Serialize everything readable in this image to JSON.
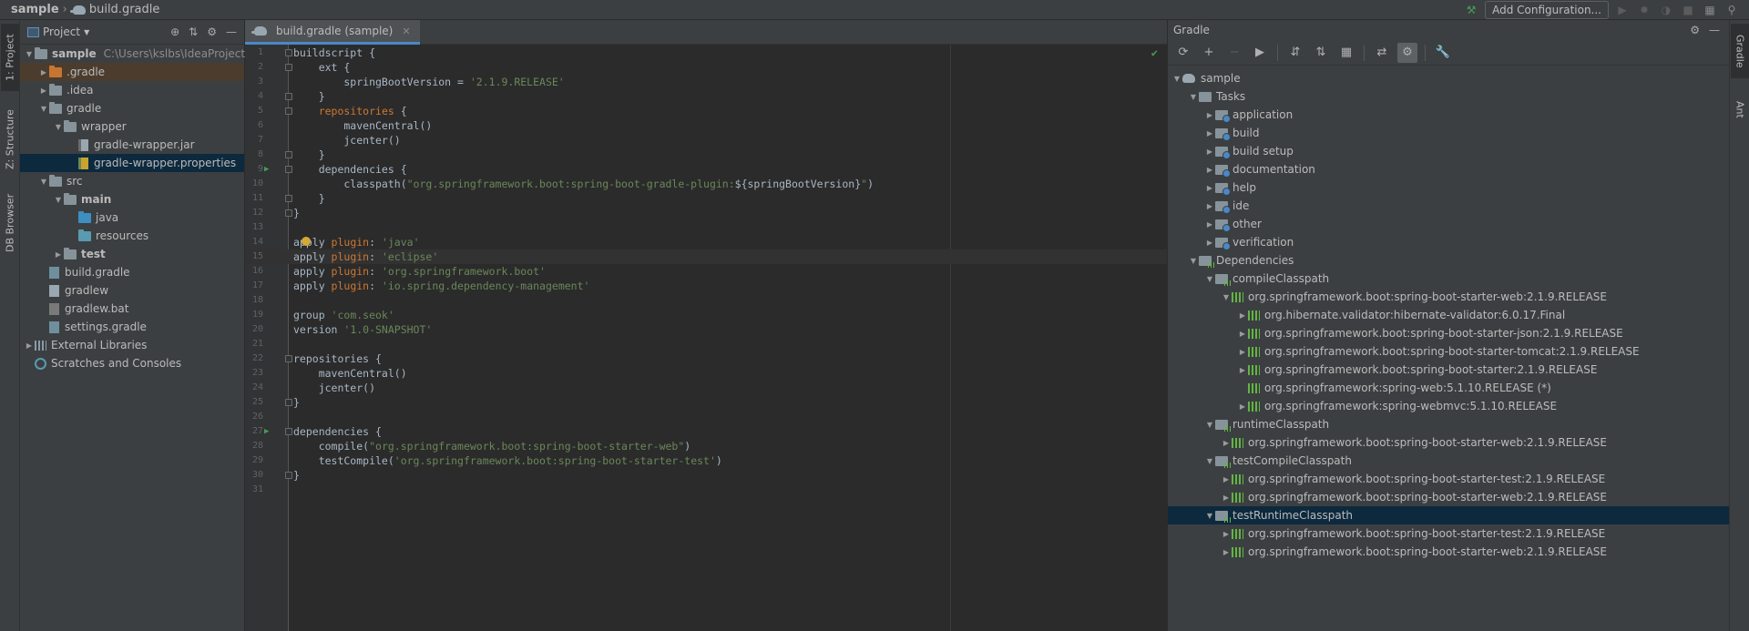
{
  "topbar": {
    "crumbs": [
      "sample",
      "build.gradle"
    ],
    "add_configuration": "Add Configuration..."
  },
  "left_stripe": {
    "tabs": [
      "1: Project",
      "Z: Structure",
      "DB Browser"
    ]
  },
  "right_stripe": {
    "tabs": [
      "Gradle",
      "Ant"
    ]
  },
  "project": {
    "selector": "Project",
    "tree": [
      {
        "label": "sample",
        "extra": "C:\\Users\\kslbs\\IdeaProjects\\",
        "icon": "folder",
        "arrow": "down",
        "bold": true
      },
      {
        "label": ".gradle",
        "icon": "folder-orange",
        "arrow": "right",
        "highlight": true
      },
      {
        "label": ".idea",
        "icon": "folder",
        "arrow": "right"
      },
      {
        "label": "gradle",
        "icon": "folder",
        "arrow": "down"
      },
      {
        "label": "wrapper",
        "icon": "folder",
        "arrow": "down"
      },
      {
        "label": "gradle-wrapper.jar",
        "icon": "file-jar",
        "arrow": ""
      },
      {
        "label": "gradle-wrapper.properties",
        "icon": "file-props",
        "arrow": "",
        "selected": true
      },
      {
        "label": "src",
        "icon": "folder",
        "arrow": "down"
      },
      {
        "label": "main",
        "icon": "folder",
        "arrow": "down",
        "bold": true
      },
      {
        "label": "java",
        "icon": "folder-blue",
        "arrow": ""
      },
      {
        "label": "resources",
        "icon": "folder-teal",
        "arrow": ""
      },
      {
        "label": "test",
        "icon": "folder",
        "arrow": "right",
        "bold": true
      },
      {
        "label": "build.gradle",
        "icon": "file-gradle",
        "arrow": ""
      },
      {
        "label": "gradlew",
        "icon": "file",
        "arrow": ""
      },
      {
        "label": "gradlew.bat",
        "icon": "file-bat",
        "arrow": ""
      },
      {
        "label": "settings.gradle",
        "icon": "file-gradle",
        "arrow": ""
      },
      {
        "label": "External Libraries",
        "icon": "libs",
        "arrow": "right"
      },
      {
        "label": "Scratches and Consoles",
        "icon": "scratches",
        "arrow": ""
      }
    ]
  },
  "editor": {
    "tab": "build.gradle (sample)",
    "lines": [
      {
        "n": "1",
        "html": "buildscript {",
        "fold": true
      },
      {
        "n": "2",
        "html": "    ext {",
        "fold": true
      },
      {
        "n": "3",
        "html": "        springBootVersion = <span class=\"str\">'2.1.9.RELEASE'</span>"
      },
      {
        "n": "4",
        "html": "    }",
        "fold": true
      },
      {
        "n": "5",
        "html": "    <span class=\"kw\">repositories</span> {",
        "fold": true
      },
      {
        "n": "6",
        "html": "        mavenCentral()"
      },
      {
        "n": "7",
        "html": "        jcenter()"
      },
      {
        "n": "8",
        "html": "    }",
        "fold": true
      },
      {
        "n": "9",
        "html": "    dependencies {",
        "fold": true,
        "run": true
      },
      {
        "n": "10",
        "html": "        classpath(<span class=\"str\">\"org.springframework.boot:spring-boot-gradle-plugin:</span>${springBootVersion}<span class=\"str\">\"</span>)"
      },
      {
        "n": "11",
        "html": "    }",
        "fold": true
      },
      {
        "n": "12",
        "html": "}",
        "fold": true
      },
      {
        "n": "13",
        "html": ""
      },
      {
        "n": "14",
        "html": "apply <span class=\"kw\">plugin</span>: <span class=\"str\">'java'</span>",
        "bulb": true
      },
      {
        "n": "15",
        "html": "apply <span class=\"kw\">plugin</span>: <span class=\"str\">'eclipse'</span>",
        "current": true
      },
      {
        "n": "16",
        "html": "apply <span class=\"kw\">plugin</span>: <span class=\"str\">'org.springframework.boot'</span>"
      },
      {
        "n": "17",
        "html": "apply <span class=\"kw\">plugin</span>: <span class=\"str\">'io.spring.dependency-management'</span>"
      },
      {
        "n": "18",
        "html": ""
      },
      {
        "n": "19",
        "html": "group <span class=\"str\">'com.seok'</span>"
      },
      {
        "n": "20",
        "html": "version <span class=\"str\">'1.0-SNAPSHOT'</span>"
      },
      {
        "n": "21",
        "html": ""
      },
      {
        "n": "22",
        "html": "repositories {",
        "fold": true
      },
      {
        "n": "23",
        "html": "    mavenCentral()"
      },
      {
        "n": "24",
        "html": "    jcenter()"
      },
      {
        "n": "25",
        "html": "}",
        "fold": true
      },
      {
        "n": "26",
        "html": ""
      },
      {
        "n": "27",
        "html": "dependencies {",
        "fold": true,
        "run": true
      },
      {
        "n": "28",
        "html": "    compile(<span class=\"str\">\"org.springframework.boot:spring-boot-starter-web\"</span>)"
      },
      {
        "n": "29",
        "html": "    testCompile(<span class=\"str\">'org.springframework.boot:spring-boot-starter-test'</span>)"
      },
      {
        "n": "30",
        "html": "}",
        "fold": true
      },
      {
        "n": "31",
        "html": ""
      }
    ]
  },
  "gradle": {
    "title": "Gradle",
    "tree": [
      {
        "label": "sample",
        "level": 0,
        "arrow": "down",
        "icon": "elephant"
      },
      {
        "label": "Tasks",
        "level": 1,
        "arrow": "down",
        "icon": "folder"
      },
      {
        "label": "application",
        "level": 2,
        "arrow": "right",
        "icon": "task"
      },
      {
        "label": "build",
        "level": 2,
        "arrow": "right",
        "icon": "task"
      },
      {
        "label": "build setup",
        "level": 2,
        "arrow": "right",
        "icon": "task"
      },
      {
        "label": "documentation",
        "level": 2,
        "arrow": "right",
        "icon": "task"
      },
      {
        "label": "help",
        "level": 2,
        "arrow": "right",
        "icon": "task"
      },
      {
        "label": "ide",
        "level": 2,
        "arrow": "right",
        "icon": "task"
      },
      {
        "label": "other",
        "level": 2,
        "arrow": "right",
        "icon": "task"
      },
      {
        "label": "verification",
        "level": 2,
        "arrow": "right",
        "icon": "task"
      },
      {
        "label": "Dependencies",
        "level": 1,
        "arrow": "down",
        "icon": "dep"
      },
      {
        "label": "compileClasspath",
        "level": 2,
        "arrow": "down",
        "icon": "dep"
      },
      {
        "label": "org.springframework.boot:spring-boot-starter-web:2.1.9.RELEASE",
        "level": 3,
        "arrow": "down",
        "icon": "bars"
      },
      {
        "label": "org.hibernate.validator:hibernate-validator:6.0.17.Final",
        "level": 4,
        "arrow": "right",
        "icon": "bars"
      },
      {
        "label": "org.springframework.boot:spring-boot-starter-json:2.1.9.RELEASE",
        "level": 4,
        "arrow": "right",
        "icon": "bars"
      },
      {
        "label": "org.springframework.boot:spring-boot-starter-tomcat:2.1.9.RELEASE",
        "level": 4,
        "arrow": "right",
        "icon": "bars"
      },
      {
        "label": "org.springframework.boot:spring-boot-starter:2.1.9.RELEASE",
        "level": 4,
        "arrow": "right",
        "icon": "bars"
      },
      {
        "label": "org.springframework:spring-web:5.1.10.RELEASE (*)",
        "level": 4,
        "arrow": "",
        "icon": "bars"
      },
      {
        "label": "org.springframework:spring-webmvc:5.1.10.RELEASE",
        "level": 4,
        "arrow": "right",
        "icon": "bars"
      },
      {
        "label": "runtimeClasspath",
        "level": 2,
        "arrow": "down",
        "icon": "dep"
      },
      {
        "label": "org.springframework.boot:spring-boot-starter-web:2.1.9.RELEASE",
        "level": 3,
        "arrow": "right",
        "icon": "bars"
      },
      {
        "label": "testCompileClasspath",
        "level": 2,
        "arrow": "down",
        "icon": "dep"
      },
      {
        "label": "org.springframework.boot:spring-boot-starter-test:2.1.9.RELEASE",
        "level": 3,
        "arrow": "right",
        "icon": "bars"
      },
      {
        "label": "org.springframework.boot:spring-boot-starter-web:2.1.9.RELEASE",
        "level": 3,
        "arrow": "right",
        "icon": "bars"
      },
      {
        "label": "testRuntimeClasspath",
        "level": 2,
        "arrow": "down",
        "icon": "dep",
        "selected": true
      },
      {
        "label": "org.springframework.boot:spring-boot-starter-test:2.1.9.RELEASE",
        "level": 3,
        "arrow": "right",
        "icon": "bars"
      },
      {
        "label": "org.springframework.boot:spring-boot-starter-web:2.1.9.RELEASE",
        "level": 3,
        "arrow": "right",
        "icon": "bars"
      }
    ]
  },
  "colors": {
    "keyword": "#cc7832",
    "string": "#6a8759",
    "selection": "#0d293e",
    "accent": "#4a88c7"
  }
}
